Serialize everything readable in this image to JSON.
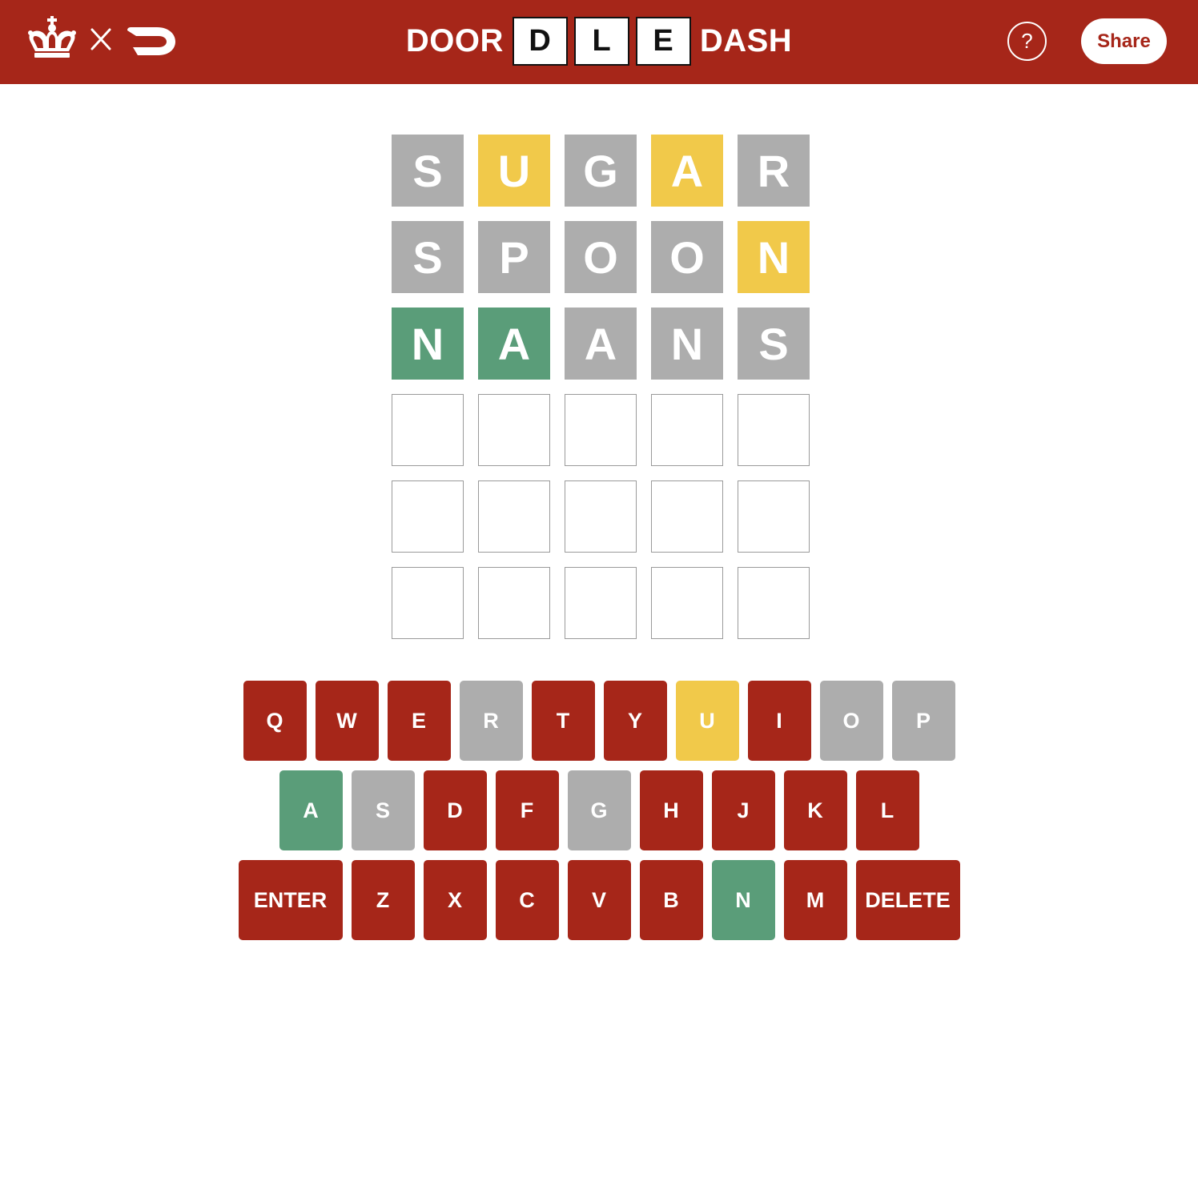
{
  "colors": {
    "header_bg": "#a62619",
    "absent": "#adadad",
    "present": "#f1c94a",
    "correct": "#5a9d79",
    "unused_key": "#a62619",
    "empty_tile_border": "#9a9a9a"
  },
  "header": {
    "left_logo_icon": "crown-icon",
    "separator_icon": "times-icon",
    "partner_logo_icon": "doordash-logo-icon",
    "title_left": "DOOR",
    "title_boxes": [
      "D",
      "L",
      "E"
    ],
    "title_right": "DASH",
    "help_label": "?",
    "share_label": "Share"
  },
  "board": {
    "rows": [
      [
        {
          "letter": "S",
          "state": "absent"
        },
        {
          "letter": "U",
          "state": "present"
        },
        {
          "letter": "G",
          "state": "absent"
        },
        {
          "letter": "A",
          "state": "present"
        },
        {
          "letter": "R",
          "state": "absent"
        }
      ],
      [
        {
          "letter": "S",
          "state": "absent"
        },
        {
          "letter": "P",
          "state": "absent"
        },
        {
          "letter": "O",
          "state": "absent"
        },
        {
          "letter": "O",
          "state": "absent"
        },
        {
          "letter": "N",
          "state": "present"
        }
      ],
      [
        {
          "letter": "N",
          "state": "correct"
        },
        {
          "letter": "A",
          "state": "correct"
        },
        {
          "letter": "A",
          "state": "absent"
        },
        {
          "letter": "N",
          "state": "absent"
        },
        {
          "letter": "S",
          "state": "absent"
        }
      ],
      [
        {
          "letter": "",
          "state": "empty"
        },
        {
          "letter": "",
          "state": "empty"
        },
        {
          "letter": "",
          "state": "empty"
        },
        {
          "letter": "",
          "state": "empty"
        },
        {
          "letter": "",
          "state": "empty"
        }
      ],
      [
        {
          "letter": "",
          "state": "empty"
        },
        {
          "letter": "",
          "state": "empty"
        },
        {
          "letter": "",
          "state": "empty"
        },
        {
          "letter": "",
          "state": "empty"
        },
        {
          "letter": "",
          "state": "empty"
        }
      ],
      [
        {
          "letter": "",
          "state": "empty"
        },
        {
          "letter": "",
          "state": "empty"
        },
        {
          "letter": "",
          "state": "empty"
        },
        {
          "letter": "",
          "state": "empty"
        },
        {
          "letter": "",
          "state": "empty"
        }
      ]
    ]
  },
  "keyboard": {
    "rows": [
      [
        {
          "label": "Q",
          "state": "unused"
        },
        {
          "label": "W",
          "state": "unused"
        },
        {
          "label": "E",
          "state": "unused"
        },
        {
          "label": "R",
          "state": "absent"
        },
        {
          "label": "T",
          "state": "unused"
        },
        {
          "label": "Y",
          "state": "unused"
        },
        {
          "label": "U",
          "state": "present"
        },
        {
          "label": "I",
          "state": "unused"
        },
        {
          "label": "O",
          "state": "absent"
        },
        {
          "label": "P",
          "state": "absent"
        }
      ],
      [
        {
          "label": "A",
          "state": "correct"
        },
        {
          "label": "S",
          "state": "absent"
        },
        {
          "label": "D",
          "state": "unused"
        },
        {
          "label": "F",
          "state": "unused"
        },
        {
          "label": "G",
          "state": "absent"
        },
        {
          "label": "H",
          "state": "unused"
        },
        {
          "label": "J",
          "state": "unused"
        },
        {
          "label": "K",
          "state": "unused"
        },
        {
          "label": "L",
          "state": "unused"
        }
      ],
      [
        {
          "label": "ENTER",
          "state": "unused",
          "wide": true
        },
        {
          "label": "Z",
          "state": "unused"
        },
        {
          "label": "X",
          "state": "unused"
        },
        {
          "label": "C",
          "state": "unused"
        },
        {
          "label": "V",
          "state": "unused"
        },
        {
          "label": "B",
          "state": "unused"
        },
        {
          "label": "N",
          "state": "correct"
        },
        {
          "label": "M",
          "state": "unused"
        },
        {
          "label": "DELETE",
          "state": "unused",
          "wide": true
        }
      ]
    ]
  }
}
